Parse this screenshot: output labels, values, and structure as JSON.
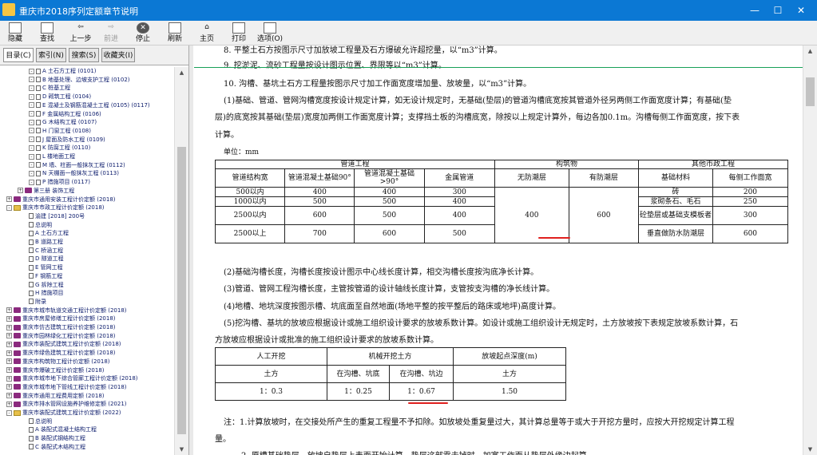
{
  "window": {
    "title": "重庆市2018序列定额章节说明",
    "minimize": "—",
    "maximize": "☐",
    "close": "✕"
  },
  "toolbar": [
    {
      "label": "隐藏",
      "icon": "hide-icon"
    },
    {
      "label": "查找",
      "icon": "find-icon"
    },
    {
      "label": "上一步",
      "icon": "back-arrow-icon"
    },
    {
      "label": "前进",
      "icon": "forward-arrow-icon"
    },
    {
      "label": "停止",
      "icon": "stop-icon"
    },
    {
      "label": "刷新",
      "icon": "refresh-icon"
    },
    {
      "label": "主页",
      "icon": "home-icon"
    },
    {
      "label": "打印",
      "icon": "print-icon"
    },
    {
      "label": "选项(O)",
      "icon": "options-icon"
    }
  ],
  "tabs": [
    "目录(C)",
    "索引(N)",
    "搜索(S)",
    "收藏夹(I)"
  ],
  "tree": [
    "A 土石方工程 (0101)",
    "B 地基处理、边坡支护工程 (0102)",
    "C 桩基工程",
    "D 砌筑工程 (0104)",
    "E 混凝土及钢筋混凝土工程 (0105) (0117)",
    "F 金属结构工程 (0106)",
    "G 木结构工程 (0107)",
    "H 门窗工程 (0108)",
    "J 屋面及防水工程 (0109)",
    "K 防腐工程 (0110)",
    "L 楼地面工程",
    "M 墙、柱面一般抹灰工程 (0112)",
    "N 天棚面一般抹灰工程 (0113)",
    "P 措施项目 (0117)",
    "第三册 装饰工程",
    "重庆市通用安装工程计价定额 (2018)",
    "重庆市市政工程计价定额 (2018)",
    "渝建 [2018] 200号",
    "总说明",
    "A 土石方工程",
    "B 道路工程",
    "C 桥涵工程",
    "D 隧道工程",
    "E 管网工程",
    "F 钢筋工程",
    "G 拆除工程",
    "H 措施项目",
    "附录",
    "重庆市城市轨道交通工程计价定额 (2018)",
    "重庆市房屋修缮工程计价定额 (2018)",
    "重庆市仿古建筑工程计价定额 (2018)",
    "重庆市园林绿化工程计价定额 (2018)",
    "重庆市装配式建筑工程计价定额 (2018)",
    "重庆市绿色建筑工程计价定额 (2018)",
    "重庆市构筑物工程计价定额 (2018)",
    "重庆市爆破工程计价定额 (2018)",
    "重庆市城市地下综合管廊工程计价定额 (2018)",
    "重庆市城市地下管线工程计价定额 (2018)",
    "重庆市通用工程费用定额 (2018)",
    "重庆市排水管网设施养护维修定额 (2021)",
    "重庆市装配式建筑工程计价定额 (2022)",
    "总说明",
    "A 装配式混凝土结构工程",
    "B 装配式钢结构工程",
    "C 装配式木结构工程"
  ],
  "doc": {
    "line_item8": "8. 平整土石方按图示尺寸加放坡工程量及石方爆破允许超挖量，以“m3”计算。",
    "line_item9": "9. 挖淤泥、流砂工程量按设计图示位置、界限等以“m3”计算。",
    "line_item10": "10. 沟槽、基坑土石方工程量按图示尺寸加工作面宽度增加量、放坡量，以“m3”计算。",
    "para1_l1": "(1)基础、管道、管网沟槽宽度按设计规定计算，如无设计规定时，无基础(垫层)的管道沟槽底宽按其管道外径另两侧工作面宽度计算；有基础(垫",
    "para1_l2": "层)的底宽按其基础(垫层)宽度加两侧工作面宽度计算；支撑挡土板的沟槽底宽，除按以上规定计算外，每边各加0.1m。沟槽每侧工作面宽度，按下表",
    "para1_l3": "计算。",
    "unit_label": "单位：mm",
    "para2": "(2)基础沟槽长度，沟槽长度按设计图示中心线长度计算，相交沟槽长度按沟底净长计算。",
    "para3": "(3)管道、管网工程沟槽长度，主管按管道的设计轴线长度计算，支管按支沟槽的净长线计算。",
    "para4": "(4)地槽、地坑深度按图示槽、坑底面至自然地面(场地平整的按平整后的路床或地坪)高度计算。",
    "para5_l1": "(5)挖沟槽、基坑的放坡应根据设计或施工组织设计要求的放坡系数计算。如设计或施工组织设计无规定时，土方放坡按下表规定放坡系数计算，石",
    "para5_l2": "方放坡应根据设计或批准的施工组织设计要求的放坡系数计算。",
    "note_l1": "注：1.计算放坡时，在交接处所产生的重复工程量不予扣除。如放坡处重复量过大，其计算总量等于或大于开挖方量时，应按大开挖规定计算工程",
    "note_l2": "量。",
    "next_line": "2. 原槽基础垫层，放坡自垫层上表面开始计算，垫层这部震去掉时，加宽工作面从垫层外缘边起算。"
  },
  "table1": {
    "group_headers": [
      "管道工程",
      "构筑物",
      "其他市政工程"
    ],
    "col_headers": [
      "管道结构宽",
      "管道混凝土基础90°",
      "管道混凝土基础>90°",
      "金属管道",
      "无防潮层",
      "有防潮层",
      "基础材料",
      "每侧工作面宽"
    ],
    "rows": [
      [
        "500以内",
        "400",
        "400",
        "300"
      ],
      [
        "1000以内",
        "500",
        "500",
        "400"
      ],
      [
        "2500以内",
        "600",
        "500",
        "400"
      ],
      [
        "2500以上",
        "700",
        "600",
        "500"
      ]
    ],
    "structure_values": [
      "400",
      "600"
    ],
    "other": [
      [
        "砖",
        "200"
      ],
      [
        "浆砌条石、毛石",
        "250"
      ],
      [
        "砼垫层或基础支模板者",
        "300"
      ],
      [
        "垂直做防水防潮层",
        "600"
      ]
    ]
  },
  "table2": {
    "headers": [
      "人工开挖",
      "机械开挖土方",
      "放坡起点深度(m)"
    ],
    "subheaders": [
      "土方",
      "在沟槽、坑底",
      "在沟槽、坑边",
      "土方"
    ],
    "values": [
      "1：0.3",
      "1：0.25",
      "1：0.67",
      "1.50"
    ]
  }
}
